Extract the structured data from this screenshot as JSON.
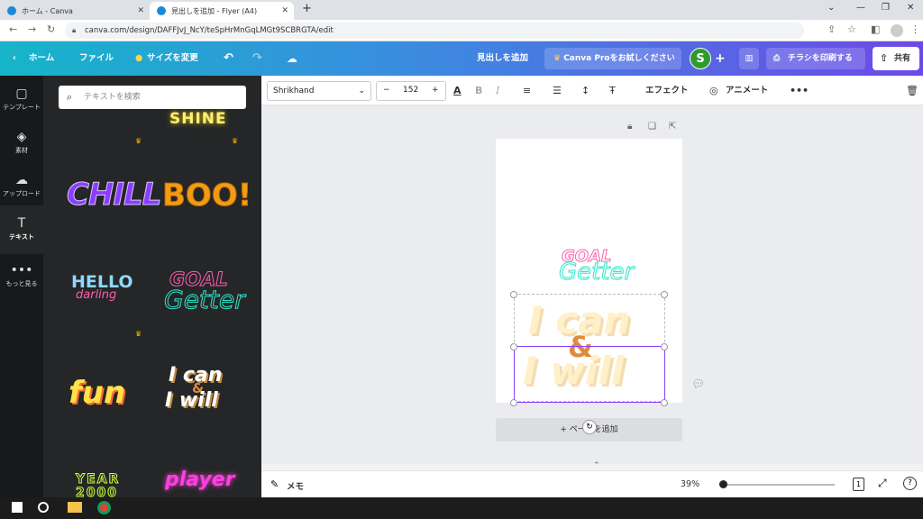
{
  "browser": {
    "tabs": [
      {
        "title": "ホーム - Canva",
        "active": false
      },
      {
        "title": "見出しを追加 - Flyer (A4)",
        "active": true
      }
    ],
    "url": "canva.com/design/DAFFJvJ_NcY/teSpHrMnGqLMGt9SCBRGTA/edit"
  },
  "header": {
    "home": "ホーム",
    "file": "ファイル",
    "resize": "サイズを変更",
    "doc_title": "見出しを追加",
    "try_pro": "Canva Proをお試しください",
    "avatar_initial": "S",
    "print": "チラシを印刷する",
    "share": "共有"
  },
  "rail": {
    "items": [
      {
        "label": "テンプレート",
        "icon": "layout-icon"
      },
      {
        "label": "素材",
        "icon": "elements-icon"
      },
      {
        "label": "アップロード",
        "icon": "upload-icon"
      },
      {
        "label": "テキスト",
        "icon": "text-icon",
        "active": true
      },
      {
        "label": "もっと見る",
        "icon": "more-icon"
      }
    ]
  },
  "panel": {
    "search_placeholder": "テキストを検索",
    "tiles": [
      "SHINE",
      "CHILL",
      "BOO!",
      "HELLO",
      "darling",
      "GOAL",
      "Getter",
      "fun",
      "I can",
      "&",
      "I will",
      "YEAR",
      "2000",
      "player"
    ]
  },
  "toolbar": {
    "font": "Shrikhand",
    "size": "152",
    "effects": "エフェクト",
    "animate": "アニメート"
  },
  "canvas": {
    "goal": "GOAL",
    "getter": "Getter",
    "line1": "I can",
    "amp": "&",
    "line2": "I will",
    "add_page": "+ ページを追加"
  },
  "bottom": {
    "notes": "メモ",
    "zoom": "39%",
    "page_num": "1"
  },
  "colors": {
    "header_start": "#16b5c9",
    "header_end": "#6d49e8",
    "selection": "#8b3dff",
    "cream": "#fff0c9",
    "orange": "#e08a3c"
  }
}
